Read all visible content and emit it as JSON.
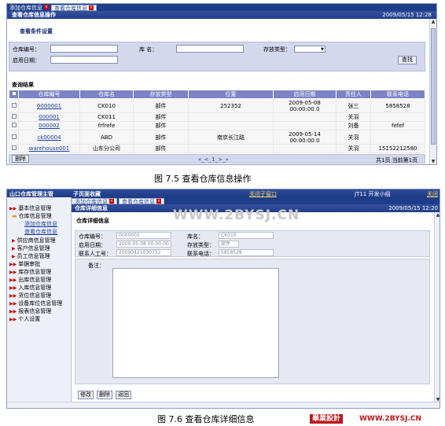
{
  "top": {
    "tabs": [
      "添加仓库信息",
      "查看仓库信息"
    ],
    "title": "查看仓库信息操作",
    "date": "2009/05/15 12:28",
    "section_filter": "查看条件设置",
    "filter": {
      "warehouse_no_label": "仓库编号：",
      "name_label": "库  名：",
      "storage_type_label": "存放类型：",
      "start_date_label": "启用日期：",
      "search_button": "查找"
    },
    "section_results": "查询结果",
    "columns": [
      "仓库编号",
      "仓库名",
      "存放类型",
      "位置",
      "启用日期",
      "责任人",
      "联系电话"
    ],
    "rows": [
      {
        "no": "0000001",
        "name": "CK010",
        "type": "部件",
        "location": "252352",
        "date": "2009-05-08 00:00:00.0",
        "person": "张三",
        "phone": "5858528"
      },
      {
        "no": "000001",
        "name": "CK011",
        "type": "部件",
        "location": "",
        "date": "",
        "person": "关羽",
        "phone": ""
      },
      {
        "no": "000002",
        "name": "frfrefe",
        "type": "部件",
        "location": "",
        "date": "",
        "person": "刘备",
        "phone": "fefef"
      },
      {
        "no": "ck00004",
        "name": "ABD",
        "type": "部件",
        "location": "南京长江路",
        "date": "2009-05-14 00:00:00.0",
        "person": "关羽",
        "phone": ""
      },
      {
        "no": "warehouse001",
        "name": "山东分公司",
        "type": "部件",
        "location": "",
        "date": "",
        "person": "关羽",
        "phone": "15152212580"
      }
    ],
    "delete_button": "删除",
    "pager": "«_<_1_>_»",
    "page_info": "共1页 当前第1页"
  },
  "caption1": "图  7.5      查看仓库信息操作",
  "bottom": {
    "app_title": "山口仓库管理主管",
    "home": "子页面收藏",
    "close_window": "关闭子窗口",
    "user": "JT11  开发小组",
    "logout": "关闭",
    "nav": [
      {
        "label": "基本信息管理",
        "kind": "top"
      },
      {
        "label": "仓库信息管理",
        "kind": "folder"
      },
      {
        "label": "添加仓库信息",
        "kind": "sub"
      },
      {
        "label": "查看仓库信息",
        "kind": "sub"
      },
      {
        "label": "供应商信息管理",
        "kind": "item"
      },
      {
        "label": "客户信息管理",
        "kind": "item"
      },
      {
        "label": "员工信息管理",
        "kind": "item"
      },
      {
        "label": "单据审批",
        "kind": "top"
      },
      {
        "label": "库存信息管理",
        "kind": "top"
      },
      {
        "label": "出库信息管理",
        "kind": "top"
      },
      {
        "label": "入库信息管理",
        "kind": "top"
      },
      {
        "label": "货位信息管理",
        "kind": "top"
      },
      {
        "label": "设备库位信息管理",
        "kind": "top"
      },
      {
        "label": "报表信息管理",
        "kind": "top"
      },
      {
        "label": "个人设置",
        "kind": "top"
      }
    ],
    "tabs": [
      "添加仓库信息",
      "查看仓库信息"
    ],
    "title": "仓库详细信息",
    "date": "2009/05/15 12:20",
    "section": "仓库详细信息",
    "fields": {
      "no_label": "仓库编号：",
      "no_value": "0000001",
      "name_label": "库名：",
      "name_value": "CK010",
      "date_label": "启用日期：",
      "date_value": "2009-05-08 00:00:00.0",
      "type_label": "存放类型：",
      "type_value": "部件",
      "contact_label": "联系人工号：",
      "contact_value": "20090421030732",
      "phone_label": "联系电话：",
      "phone_value": "5858528",
      "memo_label": "备注："
    },
    "buttons": [
      "修改",
      "删除",
      "返回"
    ],
    "watermark": "WWW.2BYSJ.CN"
  },
  "caption2": "图  7.6      查看仓库详细信息",
  "brand": {
    "box": "畢業設計",
    "text": "WWW.2BYSJ.CN"
  }
}
